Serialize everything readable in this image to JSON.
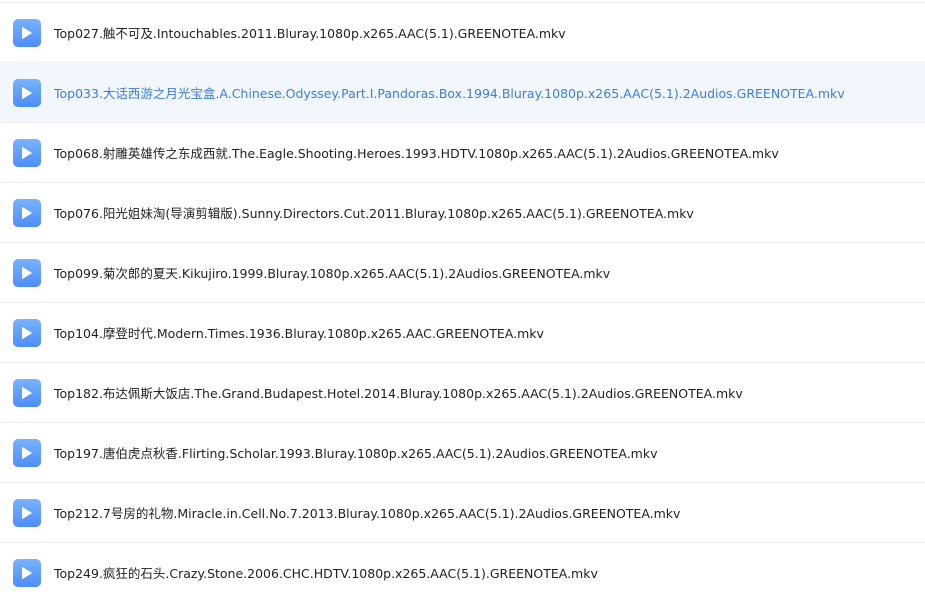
{
  "files": [
    {
      "name": "Top027.触不可及.Intouchables.2011.Bluray.1080p.x265.AAC(5.1).GREENOTEA.mkv",
      "icon": "video-play-icon",
      "hovered": false
    },
    {
      "name": "Top033.大话西游之月光宝盒.A.Chinese.Odyssey.Part.I.Pandoras.Box.1994.Bluray.1080p.x265.AAC(5.1).2Audios.GREENOTEA.mkv",
      "icon": "video-play-icon",
      "hovered": true
    },
    {
      "name": "Top068.射雕英雄传之东成西就.The.Eagle.Shooting.Heroes.1993.HDTV.1080p.x265.AAC(5.1).2Audios.GREENOTEA.mkv",
      "icon": "video-play-icon",
      "hovered": false
    },
    {
      "name": "Top076.阳光姐妹淘(导演剪辑版).Sunny.Directors.Cut.2011.Bluray.1080p.x265.AAC(5.1).GREENOTEA.mkv",
      "icon": "video-play-icon",
      "hovered": false
    },
    {
      "name": "Top099.菊次郎的夏天.Kikujiro.1999.Bluray.1080p.x265.AAC(5.1).2Audios.GREENOTEA.mkv",
      "icon": "video-play-icon",
      "hovered": false
    },
    {
      "name": "Top104.摩登时代.Modern.Times.1936.Bluray.1080p.x265.AAC.GREENOTEA.mkv",
      "icon": "video-play-icon",
      "hovered": false
    },
    {
      "name": "Top182.布达佩斯大饭店.The.Grand.Budapest.Hotel.2014.Bluray.1080p.x265.AAC(5.1).2Audios.GREENOTEA.mkv",
      "icon": "video-play-icon",
      "hovered": false
    },
    {
      "name": "Top197.唐伯虎点秋香.Flirting.Scholar.1993.Bluray.1080p.x265.AAC(5.1).2Audios.GREENOTEA.mkv",
      "icon": "video-play-icon",
      "hovered": false
    },
    {
      "name": "Top212.7号房的礼物.Miracle.in.Cell.No.7.2013.Bluray.1080p.x265.AAC(5.1).2Audios.GREENOTEA.mkv",
      "icon": "video-play-icon",
      "hovered": false
    },
    {
      "name": "Top249.疯狂的石头.Crazy.Stone.2006.CHC.HDTV.1080p.x265.AAC(5.1).GREENOTEA.mkv",
      "icon": "video-play-icon",
      "hovered": false
    }
  ],
  "colors": {
    "icon_gradient_top": "#78b2ff",
    "icon_gradient_bottom": "#4d8ef8",
    "hover_background": "#f2f7fe",
    "hover_text": "#3b7de0",
    "text": "#1f1f1f",
    "divider": "#eceef2"
  }
}
